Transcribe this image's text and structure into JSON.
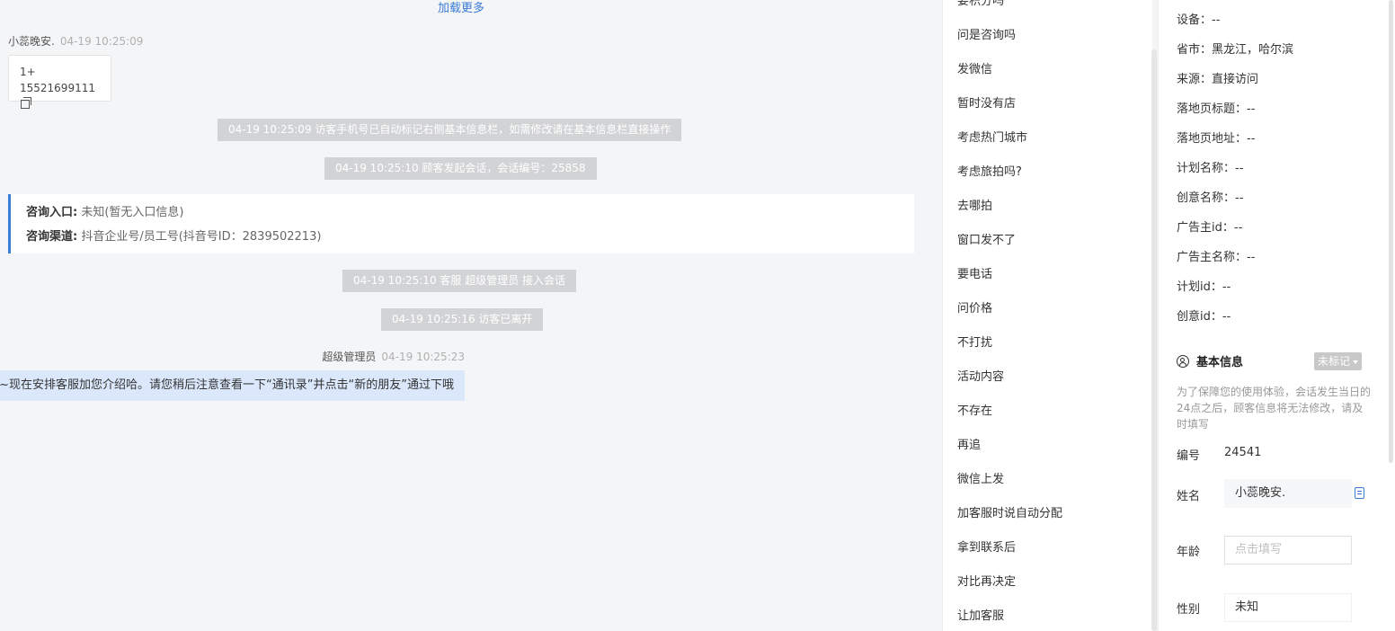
{
  "chat": {
    "load_more": "加载更多",
    "visitor_name": "小蕊晚安.",
    "visitor_time": "04-19 10:25:09",
    "phone_card": {
      "line1": "1+",
      "line2": "15521699111"
    },
    "system_messages": [
      "04-19 10:25:09 访客手机号已自动标记右侧基本信息栏，如需修改请在基本信息栏直接操作",
      "04-19 10:25:10 顾客发起会话，会话编号：25858",
      "04-19 10:25:10 客服 超级管理员 接入会话",
      "04-19 10:25:16 访客已离开"
    ],
    "info_box": {
      "entry_label": "咨询入口:",
      "entry_value": "未知(暂无入口信息)",
      "channel_label": "咨询渠道:",
      "channel_value": "抖音企业号/员工号(抖音号ID：2839502213)"
    },
    "agent_name": "超级管理员",
    "agent_time": "04-19 10:25:23",
    "agent_message": "好哒~现在安排客服加您介绍哈。请您稍后注意查看一下“通讯录”并点击“新的朋友”通过下哦"
  },
  "quick_replies": [
    "要积分吗",
    "问是咨询吗",
    "发微信",
    "暂时没有店",
    "考虑热门城市",
    "考虑旅拍吗?",
    "去哪拍",
    "窗口发不了",
    "要电话",
    "问价格",
    "不打扰",
    "活动内容",
    "不存在",
    "再追",
    "微信上发",
    "加客服时说自动分配",
    "拿到联系后",
    "对比再决定",
    "让加客服"
  ],
  "profile": {
    "details": [
      {
        "label": "设备：",
        "value": "--"
      },
      {
        "label": "省市：",
        "value": "黑龙江，哈尔滨"
      },
      {
        "label": "来源：",
        "value": "直接访问"
      },
      {
        "label": "落地页标题：",
        "value": "--"
      },
      {
        "label": "落地页地址：",
        "value": "--"
      },
      {
        "label": "计划名称：",
        "value": "--"
      },
      {
        "label": "创意名称：",
        "value": "--"
      },
      {
        "label": "广告主id：",
        "value": "--"
      },
      {
        "label": "广告主名称：",
        "value": "--"
      },
      {
        "label": "计划id：",
        "value": "--"
      },
      {
        "label": "创意id：",
        "value": "--"
      }
    ],
    "basic_info_title": "基本信息",
    "tag_button": "未标记",
    "notice": "为了保障您的使用体验，会话发生当日的24点之后，顾客信息将无法修改，请及时填写",
    "id_label": "编号",
    "id_value": "24541",
    "name_label": "姓名",
    "name_value": "小蕊晚安.",
    "age_label": "年龄",
    "age_placeholder": "点击填写",
    "gender_label": "性别",
    "gender_value": "未知"
  }
}
